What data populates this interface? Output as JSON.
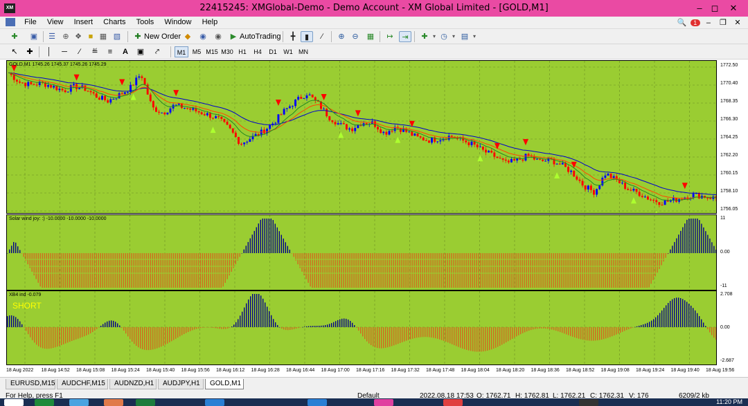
{
  "window": {
    "title": "22415245: XMGlobal-Demo - Demo Account - XM Global Limited - [GOLD,M1]",
    "app_icon": "XM",
    "controls": [
      "minimize-icon",
      "maximize-icon",
      "close-icon"
    ]
  },
  "menu": {
    "items": [
      "File",
      "View",
      "Insert",
      "Charts",
      "Tools",
      "Window",
      "Help"
    ],
    "notification_count": "1"
  },
  "toolbar": {
    "new_order_label": "New Order",
    "autotrading_label": "AutoTrading"
  },
  "timeframes": [
    "M1",
    "M5",
    "M15",
    "M30",
    "H1",
    "H4",
    "D1",
    "W1",
    "MN"
  ],
  "active_timeframe": "M1",
  "main_pane": {
    "label": "GOLD,M1  1745.26 1745.37 1745.26 1745.29",
    "price_scale": [
      "1772.50",
      "1770.40",
      "1768.35",
      "1766.30",
      "1764.25",
      "1762.20",
      "1760.15",
      "1758.10",
      "1756.05"
    ]
  },
  "indicator1": {
    "label": "Solar wind joy: :) -10.0000 -10.0000 -10.0000",
    "scale": [
      "11",
      "0.00",
      "-11"
    ]
  },
  "indicator2": {
    "label": "XB4 ind -0.079",
    "signal": "SHORT",
    "scale": [
      "2.708",
      "0.00",
      "-2.687"
    ]
  },
  "time_axis": [
    "18 Aug 2022",
    "18 Aug 14:52",
    "18 Aug 15:08",
    "18 Aug 15:24",
    "18 Aug 15:40",
    "18 Aug 15:56",
    "18 Aug 16:12",
    "18 Aug 16:28",
    "18 Aug 16:44",
    "18 Aug 17:00",
    "18 Aug 17:16",
    "18 Aug 17:32",
    "18 Aug 17:48",
    "18 Aug 18:04",
    "18 Aug 18:20",
    "18 Aug 18:36",
    "18 Aug 18:52",
    "18 Aug 19:08",
    "18 Aug 19:24",
    "18 Aug 19:40",
    "18 Aug 19:56"
  ],
  "tabs": [
    "EURUSD,M15",
    "AUDCHF,M15",
    "AUDNZD,H1",
    "AUDJPY,H1",
    "GOLD,M1"
  ],
  "active_tab": "GOLD,M1",
  "status": {
    "help": "For Help, press F1",
    "profile": "Default",
    "datetime": "2022.08.18 17:53",
    "open": "O: 1762.71",
    "high": "H: 1762.81",
    "low": "L: 1762.21",
    "close": "C: 1762.31",
    "volume": "V: 176",
    "traffic": "6209/2 kb",
    "clock": "11:20 PM"
  },
  "colors": {
    "chart_background": "#9acd32",
    "bull_candle": "#0000ff",
    "bear_candle": "#ff0000",
    "sell_arrow": "#ff0000",
    "buy_arrow": "#adff2f",
    "title_bar": "#ea4aa3",
    "histogram_positive": "#00008b",
    "histogram_negative": "#d2691e"
  },
  "chart_data": {
    "type": "candlestick",
    "price_range": [
      1755.6,
      1773.6
    ],
    "close_path": [
      1772.2,
      1771.1,
      1770.8,
      1771.0,
      1770.6,
      1770.1,
      1770.6,
      1770.3,
      1769.4,
      1768.9,
      1769.6,
      1770.4,
      1772.1,
      1768.1,
      1767.5,
      1768.4,
      1768.1,
      1767.7,
      1767.3,
      1766.8,
      1765.6,
      1763.9,
      1764.6,
      1765.3,
      1766.4,
      1767.8,
      1768.9,
      1769.8,
      1768.6,
      1767.0,
      1766.1,
      1765.6,
      1766.4,
      1766.3,
      1765.1,
      1765.9,
      1765.3,
      1764.6,
      1764.3,
      1764.5,
      1764.8,
      1764.3,
      1763.8,
      1763.0,
      1762.4,
      1761.6,
      1761.9,
      1762.5,
      1761.8,
      1762.0,
      1761.4,
      1760.5,
      1759.0,
      1758.2,
      1760.4,
      1759.6,
      1758.6,
      1758.1,
      1757.4,
      1757.0,
      1757.2,
      1757.6,
      1757.9,
      1757.7,
      1757.5
    ],
    "sell_arrow_x_fraction": [
      0.01,
      0.095,
      0.16,
      0.235,
      0.38,
      0.445,
      0.495,
      0.57,
      0.69,
      0.73,
      0.8,
      0.955
    ],
    "buy_arrow_x_fraction": [
      0.175,
      0.29,
      0.47,
      0.55,
      0.665,
      0.775,
      0.885,
      0.915
    ],
    "solar_wind_regions": [
      {
        "from": 0.0,
        "to": 0.02,
        "sign": 1
      },
      {
        "from": 0.02,
        "to": 0.33,
        "sign": -1
      },
      {
        "from": 0.33,
        "to": 0.4,
        "sign": 1
      },
      {
        "from": 0.4,
        "to": 0.93,
        "sign": -1
      },
      {
        "from": 0.93,
        "to": 1.0,
        "sign": 1
      }
    ],
    "xb4_range": [
      -2.687,
      2.708
    ]
  }
}
